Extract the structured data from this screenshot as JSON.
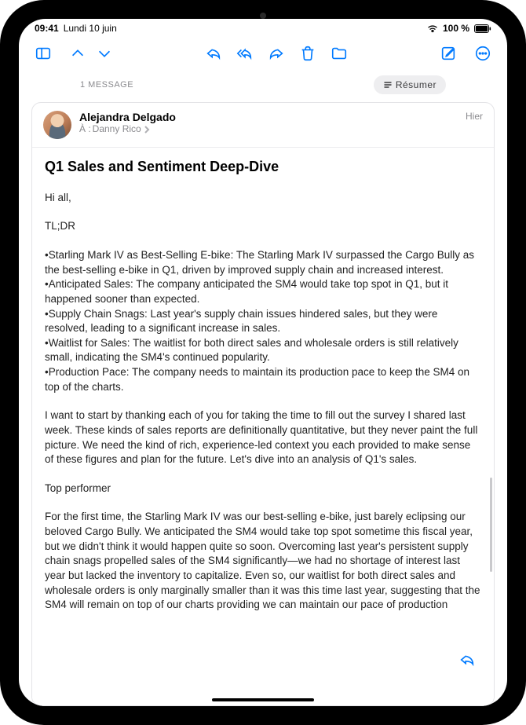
{
  "status": {
    "time": "09:41",
    "date": "Lundi 10 juin",
    "battery_text": "100 %"
  },
  "toolbar": {
    "icons": {
      "sidebar": "sidebar-icon",
      "up": "chevron-up-icon",
      "down": "chevron-down-icon",
      "reply": "reply-icon",
      "reply_all": "reply-all-icon",
      "forward": "forward-icon",
      "trash": "trash-icon",
      "folder": "folder-icon",
      "compose": "compose-icon",
      "more": "more-icon"
    }
  },
  "list": {
    "count_label": "1 MESSAGE",
    "summarize_label": "Résumer"
  },
  "email": {
    "sender": "Alejandra Delgado",
    "to_prefix": "À :",
    "to_name": "Danny Rico",
    "timestamp": "Hier",
    "subject": "Q1 Sales and Sentiment Deep-Dive",
    "greeting": "Hi all,",
    "tldr_label": "TL;DR",
    "tldr_items": [
      "•Starling Mark IV as Best-Selling E-bike: The Starling Mark IV surpassed the Cargo Bully as the best-selling e-bike in Q1, driven by improved supply chain and increased interest.",
      "•Anticipated Sales: The company anticipated the SM4 would take top spot in Q1, but it happened sooner than expected.",
      "•Supply Chain Snags: Last year's supply chain issues hindered sales, but they were resolved, leading to a significant increase in sales.",
      "•Waitlist for Sales: The waitlist for both direct sales and wholesale orders is still relatively small, indicating the SM4's continued popularity.",
      "•Production Pace: The company needs to maintain its production pace to keep the SM4 on top of the charts."
    ],
    "para1": "I want to start by thanking each of you for taking the time to fill out the survey I shared last week. These kinds of sales reports are definitionally quantitative, but they never paint the full picture. We need the kind of rich, experience-led context you each provided to make sense of these figures and plan for the future. Let's dive into an analysis of Q1's sales.",
    "section_heading": "Top performer",
    "para2": "For the first time, the Starling Mark IV was our best-selling e-bike, just barely eclipsing our beloved Cargo Bully. We anticipated the SM4 would take top spot sometime this fiscal year, but we didn't think it would happen quite so soon. Overcoming last year's persistent supply chain snags propelled sales of the SM4 significantly—we had no shortage of interest last year but lacked the inventory to capitalize. Even so, our waitlist for both direct sales and wholesale orders is only marginally smaller than it was this time last year, suggesting that the SM4 will remain on top of our charts providing we can maintain our pace of production"
  }
}
